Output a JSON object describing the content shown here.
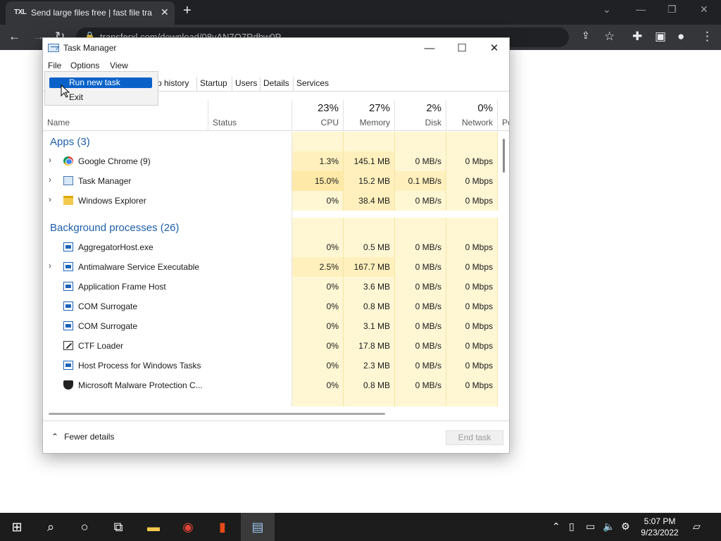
{
  "browser": {
    "tab_title": "Send large files free | fast file tra",
    "tab_favicon": "TXL",
    "address": "transferxl.com/download/08vAN7Q7Rdbw0P"
  },
  "window": {
    "title": "Task Manager",
    "menu": [
      "File",
      "Options",
      "View"
    ],
    "tabs": [
      "p history",
      "Startup",
      "Users",
      "Details",
      "Services"
    ],
    "dropdown": [
      "Run new task",
      "Exit"
    ]
  },
  "columns": {
    "name": "Name",
    "status": "Status",
    "cpu": {
      "pct": "23%",
      "label": "CPU"
    },
    "memory": {
      "pct": "27%",
      "label": "Memory"
    },
    "disk": {
      "pct": "2%",
      "label": "Disk"
    },
    "network": {
      "pct": "0%",
      "label": "Network"
    },
    "power": "Po"
  },
  "groups": {
    "apps": "Apps (3)",
    "background": "Background processes (26)"
  },
  "apps": [
    {
      "name": "Google Chrome (9)",
      "icon": "chrome-icon",
      "cpu": "1.3%",
      "mem": "145.1 MB",
      "disk": "0 MB/s",
      "net": "0 Mbps"
    },
    {
      "name": "Task Manager",
      "icon": "task-manager-icon",
      "cpu": "15.0%",
      "mem": "15.2 MB",
      "disk": "0.1 MB/s",
      "net": "0 Mbps"
    },
    {
      "name": "Windows Explorer",
      "icon": "folder-icon",
      "cpu": "0%",
      "mem": "38.4 MB",
      "disk": "0 MB/s",
      "net": "0 Mbps"
    }
  ],
  "background": [
    {
      "name": "AggregatorHost.exe",
      "cpu": "0%",
      "mem": "0.5 MB",
      "disk": "0 MB/s",
      "net": "0 Mbps"
    },
    {
      "name": "Antimalware Service Executable",
      "cpu": "2.5%",
      "mem": "167.7 MB",
      "disk": "0 MB/s",
      "net": "0 Mbps"
    },
    {
      "name": "Application Frame Host",
      "cpu": "0%",
      "mem": "3.6 MB",
      "disk": "0 MB/s",
      "net": "0 Mbps"
    },
    {
      "name": "COM Surrogate",
      "cpu": "0%",
      "mem": "0.8 MB",
      "disk": "0 MB/s",
      "net": "0 Mbps"
    },
    {
      "name": "COM Surrogate",
      "cpu": "0%",
      "mem": "3.1 MB",
      "disk": "0 MB/s",
      "net": "0 Mbps"
    },
    {
      "name": "CTF Loader",
      "cpu": "0%",
      "mem": "17.8 MB",
      "disk": "0 MB/s",
      "net": "0 Mbps"
    },
    {
      "name": "Host Process for Windows Tasks",
      "cpu": "0%",
      "mem": "2.3 MB",
      "disk": "0 MB/s",
      "net": "0 Mbps"
    },
    {
      "name": "Microsoft Malware Protection C...",
      "cpu": "0%",
      "mem": "0.8 MB",
      "disk": "0 MB/s",
      "net": "0 Mbps"
    }
  ],
  "footer": {
    "fewer_details": "Fewer details",
    "end_task": "End task"
  },
  "taskbar": {
    "time": "5:07 PM",
    "date": "9/23/2022"
  }
}
